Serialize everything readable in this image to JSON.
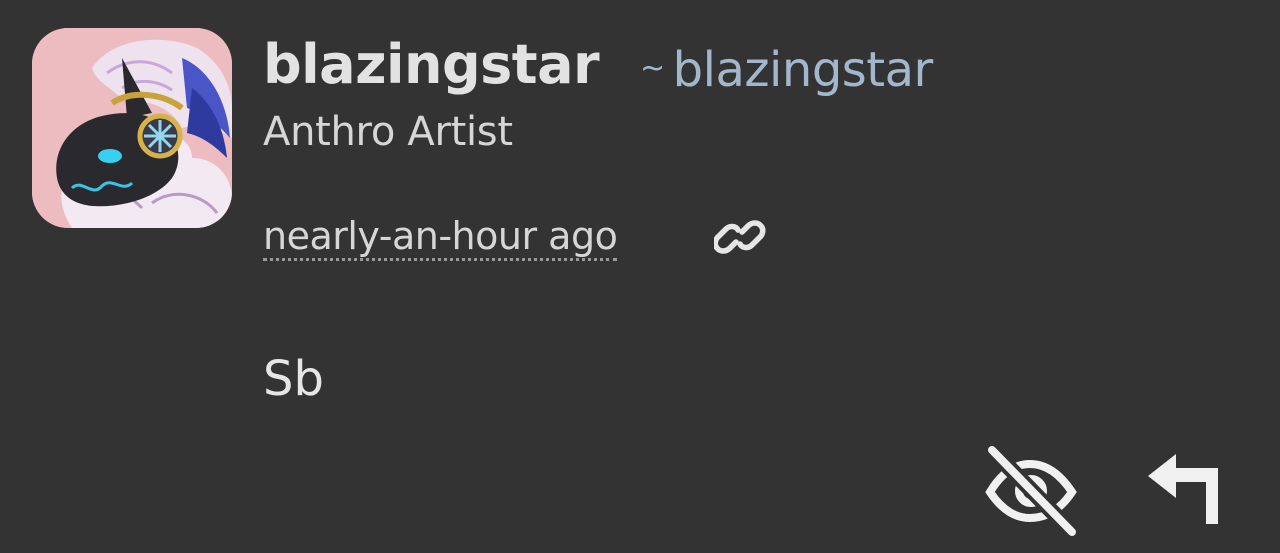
{
  "post": {
    "author": {
      "display_name": "blazingstar",
      "handle_prefix": "~",
      "handle": "blazingstar",
      "tagline": "Anthro Artist",
      "avatar_icon": "avatar-image"
    },
    "timestamp": "nearly-an-hour ago",
    "body": "Sb",
    "actions": {
      "permalink_icon": "link-icon",
      "hide_icon": "eye-slash-icon",
      "reply_icon": "reply-arrow-icon"
    }
  },
  "colors": {
    "background": "#333333",
    "handle": "#a3b7cc",
    "text": "#e2e2e2"
  }
}
